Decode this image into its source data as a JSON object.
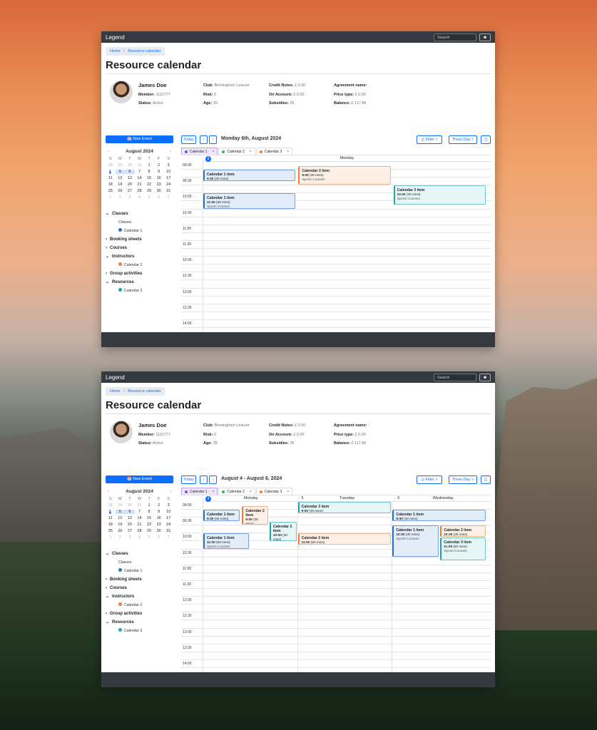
{
  "app": {
    "brand": "Legend",
    "search_placeholder": "Search",
    "user_icon": "user-icon"
  },
  "breadcrumb": {
    "home": "Home",
    "sep": "/",
    "current": "Resource calendar"
  },
  "page": {
    "title": "Resource calendar"
  },
  "profile": {
    "name": "James Doe",
    "member_label": "Member:",
    "member": "1111777",
    "status_label": "Status:",
    "status": "Active",
    "club_label": "Club:",
    "club": "Birmingham Leisure",
    "risk_label": "Risk:",
    "risk": "0",
    "age_label": "Age:",
    "age": "35",
    "credit_label": "Credit Notes:",
    "credit": "£ 0.00",
    "account_label": "On Account:",
    "account": "£ 0.00",
    "subsidies_label": "Subsidies:",
    "subsidies": "35",
    "agreement_label": "Agreement name:",
    "agreement": "",
    "price_label": "Price type:",
    "price": "£ 0.00",
    "balance_label": "Balance:",
    "balance": "£ 117.86"
  },
  "sidebar": {
    "new_event": "New Event",
    "month": "August 2024",
    "weekdays": [
      "S",
      "M",
      "T",
      "W",
      "T",
      "F",
      "S"
    ],
    "days": [
      [
        "28",
        "o"
      ],
      [
        "29",
        "o"
      ],
      [
        "30",
        "o"
      ],
      [
        "31",
        "o"
      ],
      [
        "1",
        ""
      ],
      [
        "2",
        ""
      ],
      [
        "3",
        ""
      ],
      [
        "4",
        "today"
      ],
      [
        "5",
        "sel"
      ],
      [
        "6",
        "sel"
      ],
      [
        "7",
        ""
      ],
      [
        "8",
        ""
      ],
      [
        "9",
        ""
      ],
      [
        "10",
        ""
      ],
      [
        "11",
        ""
      ],
      [
        "12",
        ""
      ],
      [
        "13",
        ""
      ],
      [
        "14",
        ""
      ],
      [
        "15",
        ""
      ],
      [
        "16",
        ""
      ],
      [
        "17",
        ""
      ],
      [
        "18",
        ""
      ],
      [
        "19",
        ""
      ],
      [
        "20",
        ""
      ],
      [
        "21",
        ""
      ],
      [
        "22",
        ""
      ],
      [
        "23",
        ""
      ],
      [
        "24",
        ""
      ],
      [
        "25",
        ""
      ],
      [
        "26",
        ""
      ],
      [
        "27",
        ""
      ],
      [
        "28",
        ""
      ],
      [
        "29",
        ""
      ],
      [
        "30",
        ""
      ],
      [
        "31",
        ""
      ],
      [
        "1",
        "o"
      ],
      [
        "2",
        "o"
      ],
      [
        "3",
        "o"
      ],
      [
        "4",
        "o"
      ],
      [
        "5",
        "o"
      ],
      [
        "6",
        "o"
      ],
      [
        "7",
        "o"
      ]
    ],
    "tree": [
      {
        "label": "Classes",
        "open": true,
        "sub": [
          {
            "label": "Classes"
          },
          {
            "label": "Calendar 1",
            "color": "#2f6fc1"
          }
        ]
      },
      {
        "label": "Booking sheets",
        "open": false,
        "sub": []
      },
      {
        "label": "Courses",
        "open": false,
        "sub": []
      },
      {
        "label": "Instructors",
        "open": true,
        "sub": [
          {
            "label": "Calendar 2",
            "color": "#ee7d3a"
          }
        ]
      },
      {
        "label": "Group activities",
        "open": false,
        "sub": []
      },
      {
        "label": "Resources",
        "open": true,
        "sub": [
          {
            "label": "Calendar 3",
            "color": "#22a2a6"
          }
        ]
      }
    ]
  },
  "toolbar": {
    "today": "Today",
    "prev": "‹",
    "next": "›",
    "filter": "Filter",
    "view": "Three Day"
  },
  "calendars": [
    {
      "label": "Calendar 1",
      "color": "#7b4fd6"
    },
    {
      "label": "Calendar 2",
      "color": "#2db36b"
    },
    {
      "label": "Calendar 3",
      "color": "#ee7d3a"
    }
  ],
  "times": [
    "09:00",
    "09:30",
    "10:00",
    "10:30",
    "11:00",
    "11:30",
    "12:00",
    "12:30",
    "13:00",
    "13:30",
    "14:00",
    "14:30"
  ],
  "views": [
    {
      "range": "Monday 6th, August 2024",
      "days": [
        {
          "num": "6",
          "name": "Monday",
          "current": true
        }
      ],
      "events": [
        {
          "cal": 1,
          "title": "Calendar 1 item",
          "time": "9:30",
          "dur": "(30 mins)",
          "sub": "Sports Courses",
          "day": 0,
          "start": 9.5,
          "end": 10.25,
          "l": 0,
          "w": 0.33
        },
        {
          "cal": 2,
          "title": "Calendar 2 item",
          "time": "9:00",
          "dur": "(30 mins)",
          "sub": "Sports Courses",
          "day": 0,
          "start": 9.25,
          "end": 10.5,
          "l": 0.335,
          "w": 0.33
        },
        {
          "cal": 3,
          "title": "Calendar 3 item",
          "time": "10:00",
          "dur": "(30 mins)",
          "sub": "Sports Courses",
          "day": 0,
          "start": 10.5,
          "end": 11.75,
          "l": 0.67,
          "w": 0.33
        },
        {
          "cal": 1,
          "title": "Calendar 1 item",
          "time": "11:00",
          "dur": "(60 mins)",
          "sub": "Sports Courses",
          "day": 0,
          "start": 11.0,
          "end": 12.0,
          "l": 0,
          "w": 0.33
        }
      ]
    },
    {
      "range": "August 4 - August 6, 2024",
      "days": [
        {
          "num": "4",
          "name": "Monday",
          "current": true
        },
        {
          "num": "5",
          "name": "Tuesday",
          "current": false
        },
        {
          "num": "6",
          "name": "Wednesday",
          "current": false
        }
      ],
      "events": [
        {
          "cal": 1,
          "title": "Calendar 1 item",
          "time": "9:30",
          "dur": "(30 mins)",
          "sub": "Sports Courses",
          "day": 0,
          "start": 9.5,
          "end": 10.25,
          "l": 0,
          "w": 0.4
        },
        {
          "cal": 2,
          "title": "Calendar 2 item",
          "time": "9:00",
          "dur": "(30 mins)",
          "sub": "Sports Courses",
          "day": 0,
          "start": 9.25,
          "end": 10.5,
          "l": 0.41,
          "w": 0.29
        },
        {
          "cal": 3,
          "title": "Calendar 3 item",
          "time": "10:00",
          "dur": "(30 mins)",
          "sub": "Sports Courses",
          "day": 0,
          "start": 10.25,
          "end": 11.5,
          "l": 0.7,
          "w": 0.3
        },
        {
          "cal": 1,
          "title": "Calendar 1 item",
          "time": "11:00",
          "dur": "(60 mins)",
          "sub": "Sports Courses",
          "day": 0,
          "start": 11.0,
          "end": 12.0,
          "l": 0,
          "w": 0.5
        },
        {
          "cal": 3,
          "title": "Calendar 3 item",
          "time": "9:00",
          "dur": "(30 mins)",
          "sub": "Sports Courses",
          "day": 1,
          "start": 9.0,
          "end": 9.75,
          "l": 0,
          "w": 1
        },
        {
          "cal": 2,
          "title": "Calendar 2 item",
          "time": "11:00",
          "dur": "(60 mins)",
          "sub": "Sports Courses",
          "day": 1,
          "start": 11.0,
          "end": 11.75,
          "l": 0,
          "w": 1
        },
        {
          "cal": 1,
          "title": "Calendar 1 item",
          "time": "9:30",
          "dur": "(30 mins)",
          "sub": "Sports Courses",
          "day": 2,
          "start": 9.5,
          "end": 10.25,
          "l": 0,
          "w": 1
        },
        {
          "cal": 1,
          "title": "Calendar 1 item",
          "time": "10:30",
          "dur": "(30 mins)",
          "sub": "Sports Courses",
          "day": 2,
          "start": 10.5,
          "end": 12.5,
          "l": 0,
          "w": 0.5
        },
        {
          "cal": 2,
          "title": "Calendar 2 item",
          "time": "10:30",
          "dur": "(30 mins)",
          "sub": "Sports Courses",
          "day": 2,
          "start": 10.5,
          "end": 11.25,
          "l": 0.505,
          "w": 0.495
        },
        {
          "cal": 3,
          "title": "Calendar 3 item",
          "time": "11:00",
          "dur": "(60 mins)",
          "sub": "Sports Courses",
          "day": 2,
          "start": 11.25,
          "end": 12.75,
          "l": 0.505,
          "w": 0.495
        }
      ]
    }
  ]
}
